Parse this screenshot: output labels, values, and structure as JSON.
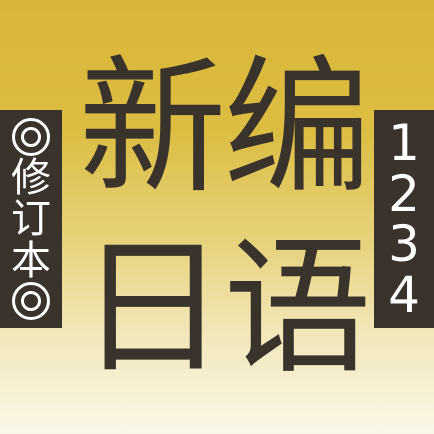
{
  "title": {
    "chars": [
      "新",
      "编",
      "日",
      "语"
    ]
  },
  "left_banner": {
    "chars": [
      "修",
      "订",
      "本"
    ]
  },
  "right_banner": {
    "digits": [
      "1",
      "2",
      "3",
      "4"
    ]
  },
  "colors": {
    "gradient_top": "#d9b638",
    "gradient_bottom": "#fbf7e8",
    "title_text": "#3a332c",
    "banner_bg": "#3a332c",
    "banner_text": "#ffffff"
  }
}
